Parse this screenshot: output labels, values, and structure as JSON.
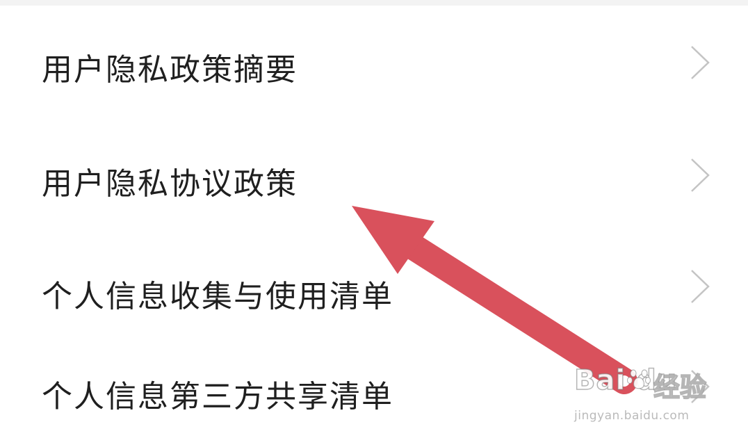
{
  "list": {
    "items": [
      {
        "label": "用户隐私政策摘要"
      },
      {
        "label": "用户隐私协议政策"
      },
      {
        "label": "个人信息收集与使用清单"
      },
      {
        "label": "个人信息第三方共享清单"
      }
    ]
  },
  "annotation": {
    "arrow_color": "#d9515c"
  },
  "watermark": {
    "brand": "Bai du",
    "suffix": "经验",
    "url": "jingyan.baidu.com"
  },
  "colors": {
    "text": "#1f1f1f",
    "chevron": "#c4c4c4",
    "background": "#ffffff"
  }
}
